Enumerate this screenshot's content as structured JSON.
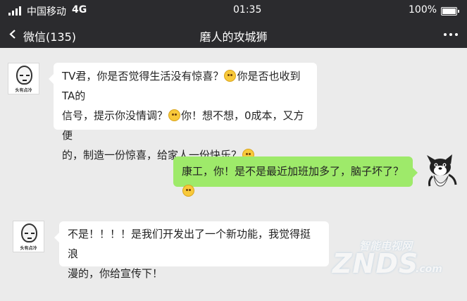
{
  "status_bar": {
    "carrier": "中国移动",
    "network": "4G",
    "time": "01:35",
    "battery": "100%"
  },
  "nav": {
    "back_label": "微信(135)",
    "title": "磨人的攻城狮",
    "more_icon": "more-dots-icon"
  },
  "messages": [
    {
      "side": "left",
      "avatar_caption": "头有点冷",
      "line1_a": "TV君，你是否觉得生活没有惊喜？",
      "line1_b": "你是否也收到TA的",
      "line2_a": "信号，提示你没情调？",
      "line2_b": "你！想不想，0成本，又方便",
      "line3": "的，制造一份惊喜，给家人一份快乐？"
    },
    {
      "side": "right",
      "text": "康工，你！是不是最近加班加多了，脑子坏了？"
    },
    {
      "side": "left",
      "avatar_caption": "头有点冷",
      "line1": "不是！！！！是我们开发出了一个新功能，我觉得挺浪",
      "line2": "漫的，你给宣传下！"
    }
  ],
  "watermark": {
    "top": "智能电视网",
    "main": "ZNDS",
    "suffix": ".com"
  },
  "colors": {
    "bar": "#2b2b2e",
    "background": "#ebebeb",
    "bubble_self": "#9eea6a",
    "bubble_other": "#ffffff"
  }
}
